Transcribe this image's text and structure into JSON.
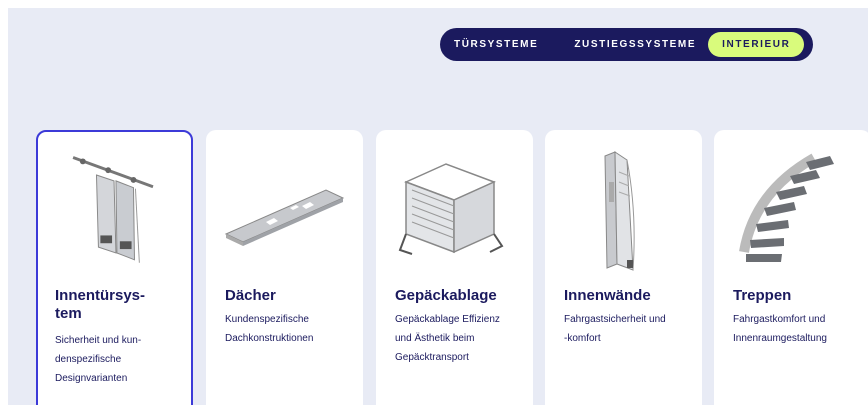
{
  "tabs": [
    {
      "label": "TÜRSYSTEME",
      "active": false
    },
    {
      "label": "ZUSTIEGSSYSTEME",
      "active": false
    },
    {
      "label": "INTERIEUR",
      "active": true
    }
  ],
  "colors": {
    "background": "#e8ebf5",
    "navy": "#1b1a5e",
    "accent_lime": "#d9fb7c",
    "selected_border": "#3c3ad8"
  },
  "cards": [
    {
      "title": "Innentürsys-\ntem",
      "description": "Sicherheit und kun-\ndenspezifische\nDesignvarianten",
      "icon": "sliding-door-illustration",
      "selected": true
    },
    {
      "title": "Dächer",
      "description": "Kundenspezifische\nDachkonstruktionen",
      "icon": "roof-panel-illustration",
      "selected": false
    },
    {
      "title": "Gepäckablage",
      "description": "Gepäckablage Effizienz\nund Ästhetik beim\nGepäcktransport",
      "icon": "luggage-rack-illustration",
      "selected": false
    },
    {
      "title": "Innenwände",
      "description": "Fahrgastsicherheit und\n-komfort",
      "icon": "interior-wall-illustration",
      "selected": false
    },
    {
      "title": "Treppen",
      "description": "Fahrgastkomfort und\nInnenraumgestaltung",
      "icon": "spiral-staircase-illustration",
      "selected": false
    }
  ]
}
